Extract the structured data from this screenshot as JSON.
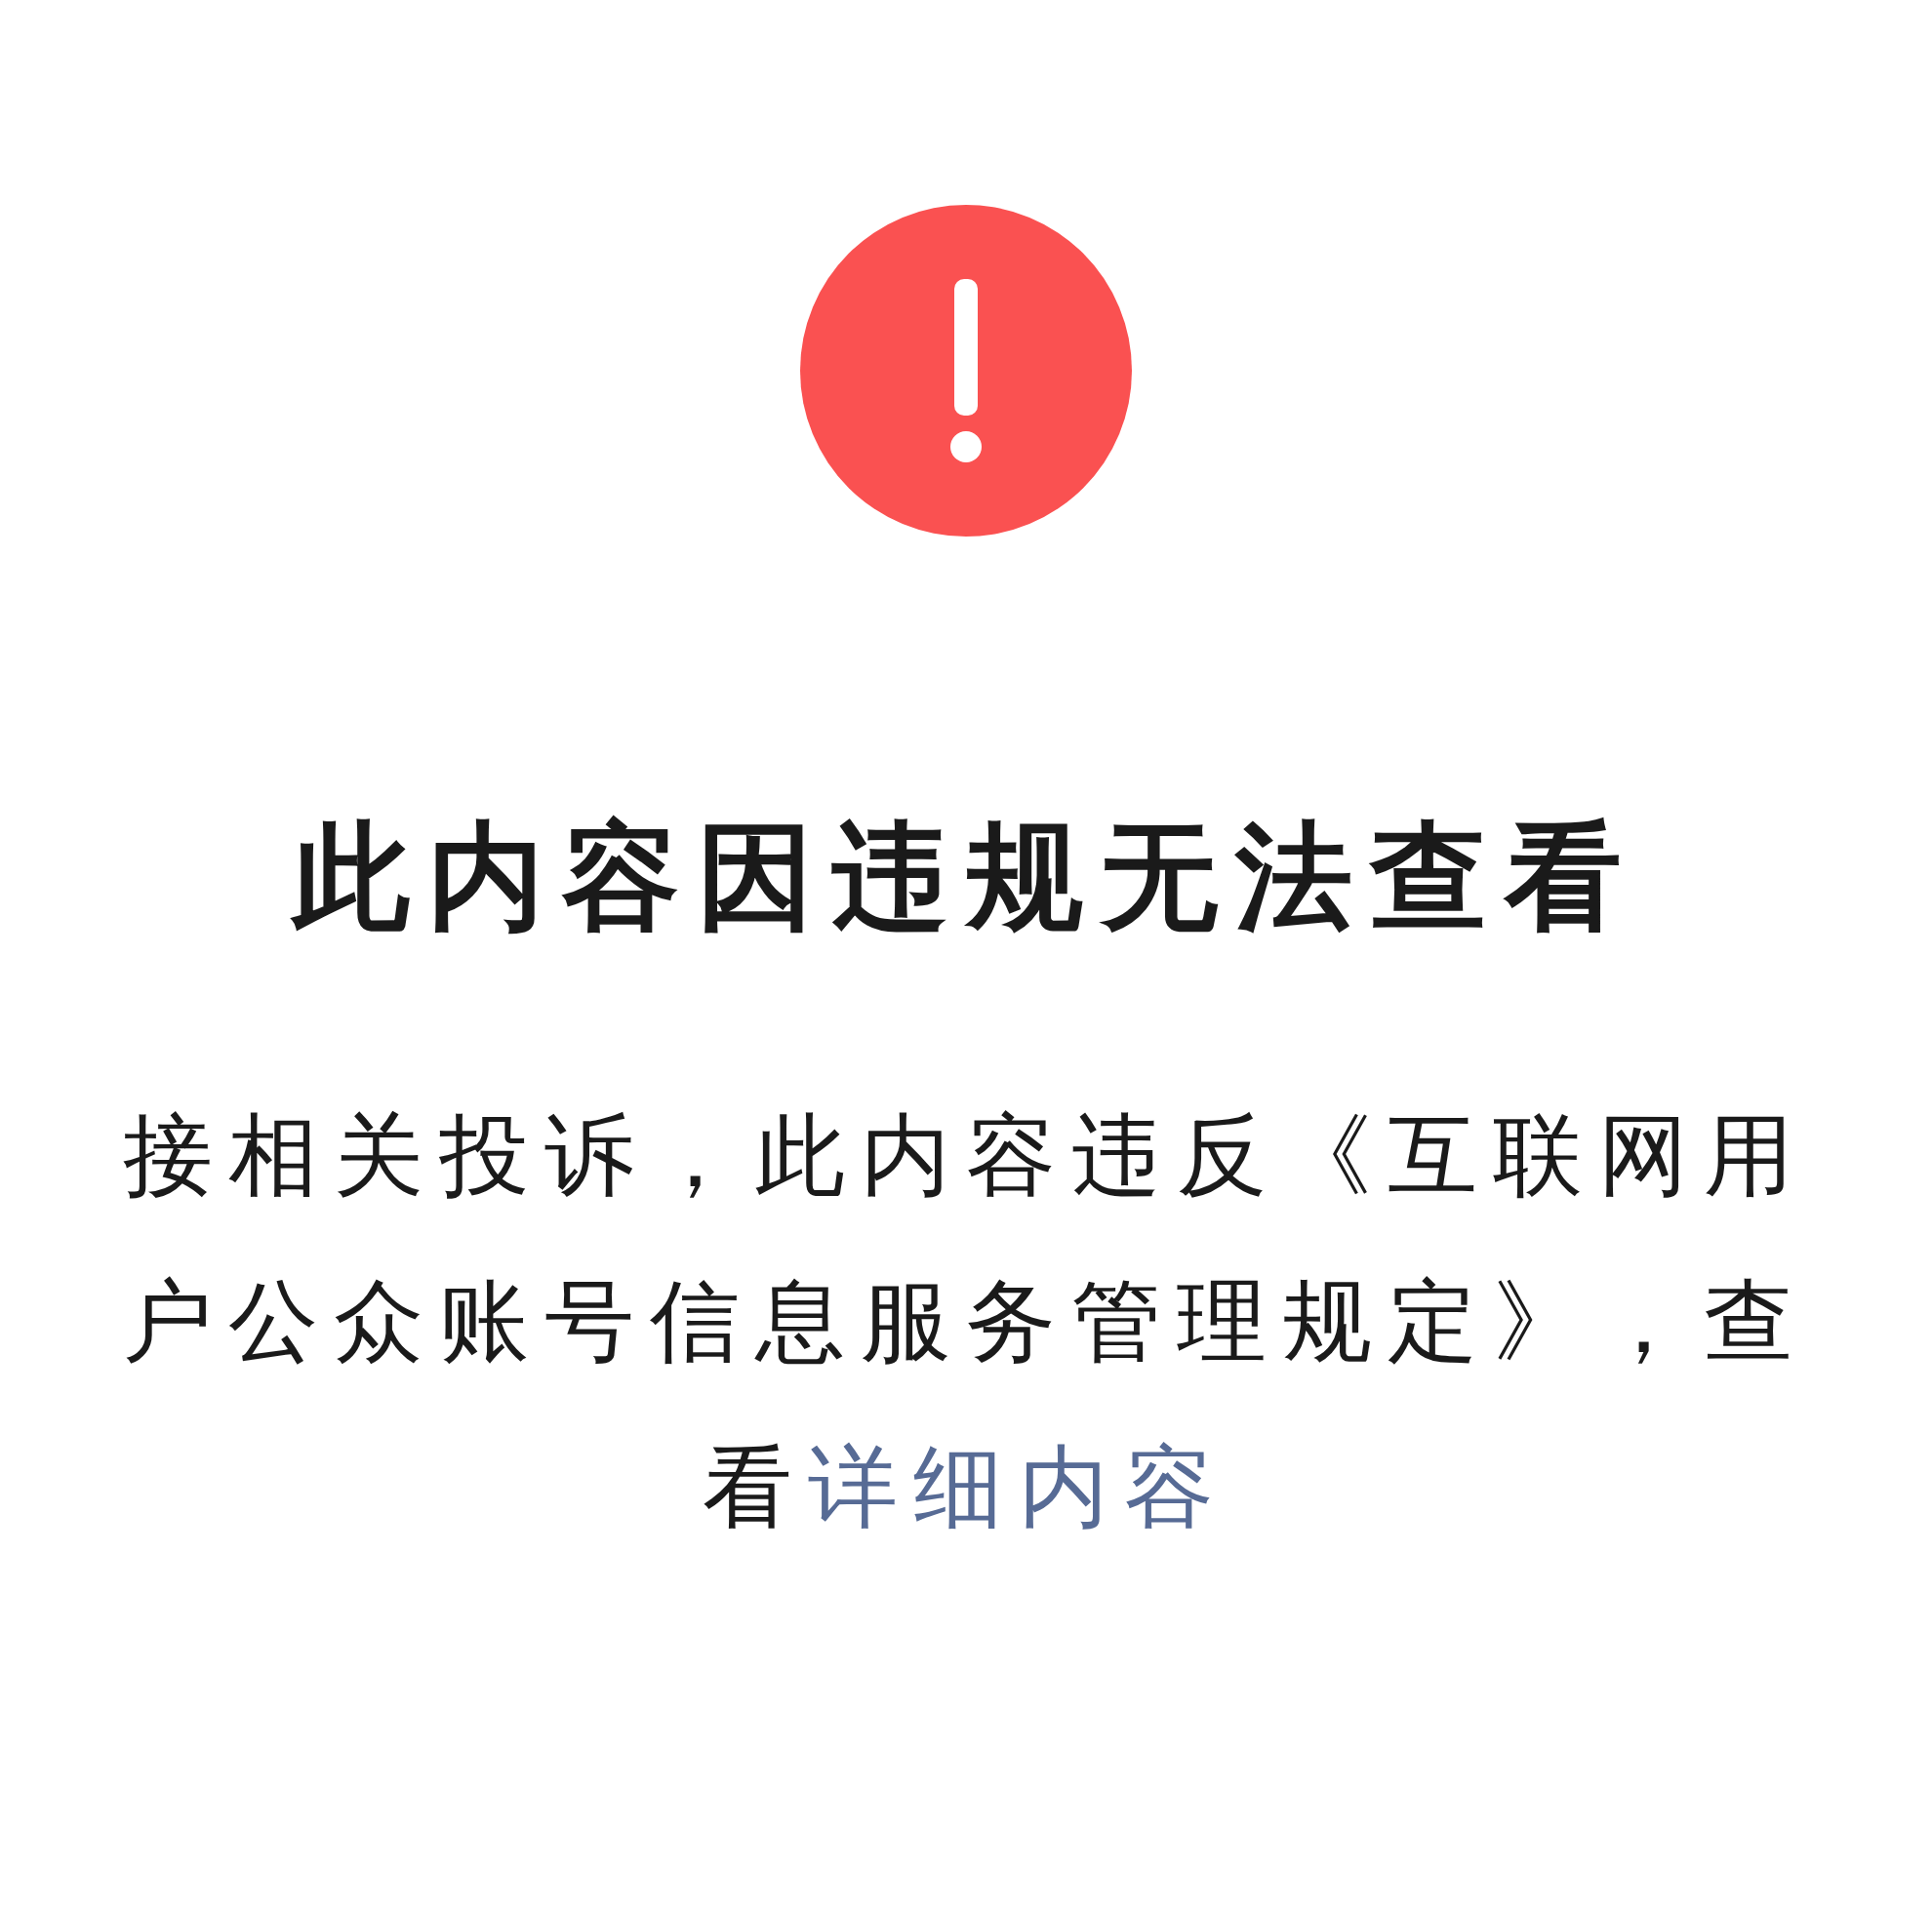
{
  "title": "此内容因违规无法查看",
  "message": {
    "text": "接相关投诉，此内容违反《互联网用户公众账号信息服务管理规定》，查看",
    "link": "详细内容"
  }
}
